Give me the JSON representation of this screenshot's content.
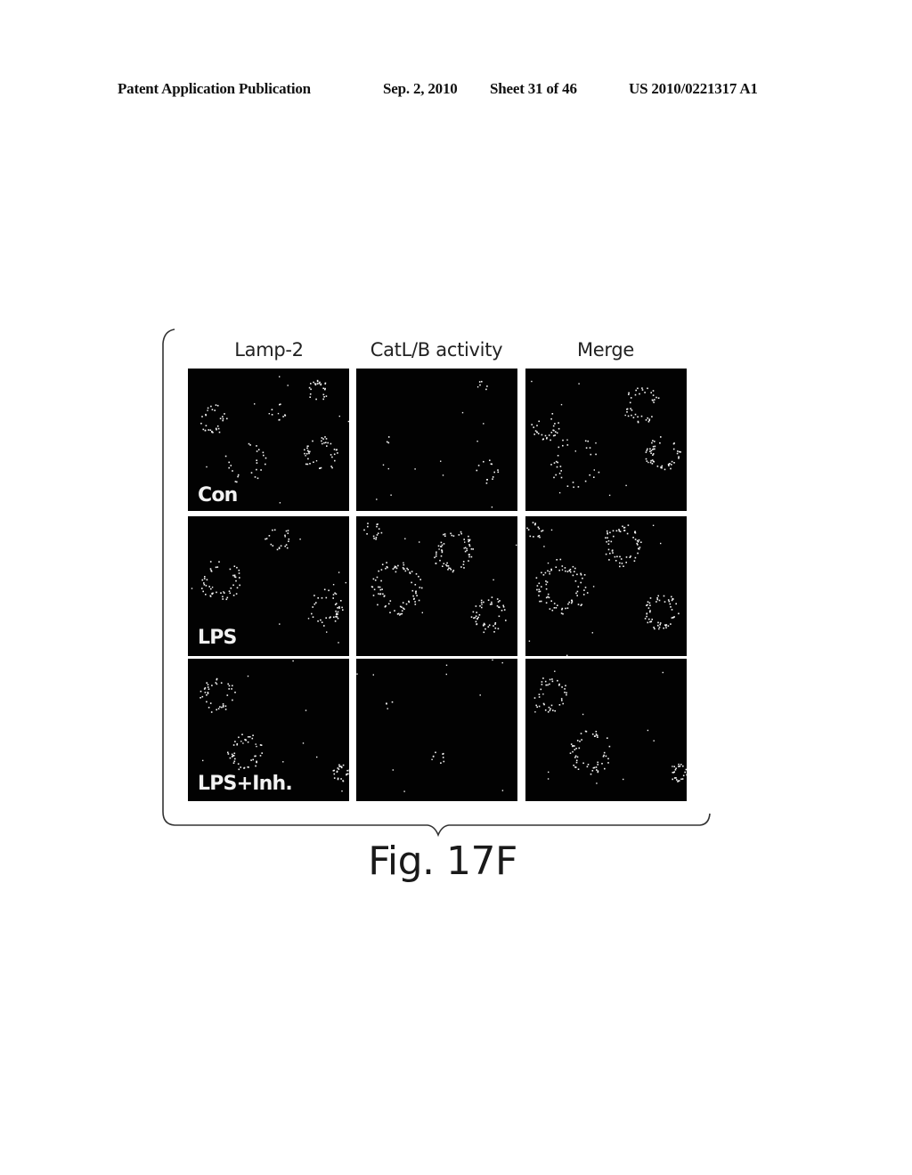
{
  "header": {
    "publication_label": "Patent Application Publication",
    "date": "Sep. 2, 2010",
    "sheet": "Sheet 31 of 46",
    "patent_number": "US 2010/0221317 A1"
  },
  "figure": {
    "caption": "Fig. 17F",
    "columns": [
      "Lamp-2",
      "CatL/B activity",
      "Merge"
    ],
    "rows": [
      {
        "label": "Con"
      },
      {
        "label": "LPS"
      },
      {
        "label": "LPS+Inh."
      }
    ],
    "panel_background": "#020202",
    "signal_color": "#f4f4f4"
  }
}
